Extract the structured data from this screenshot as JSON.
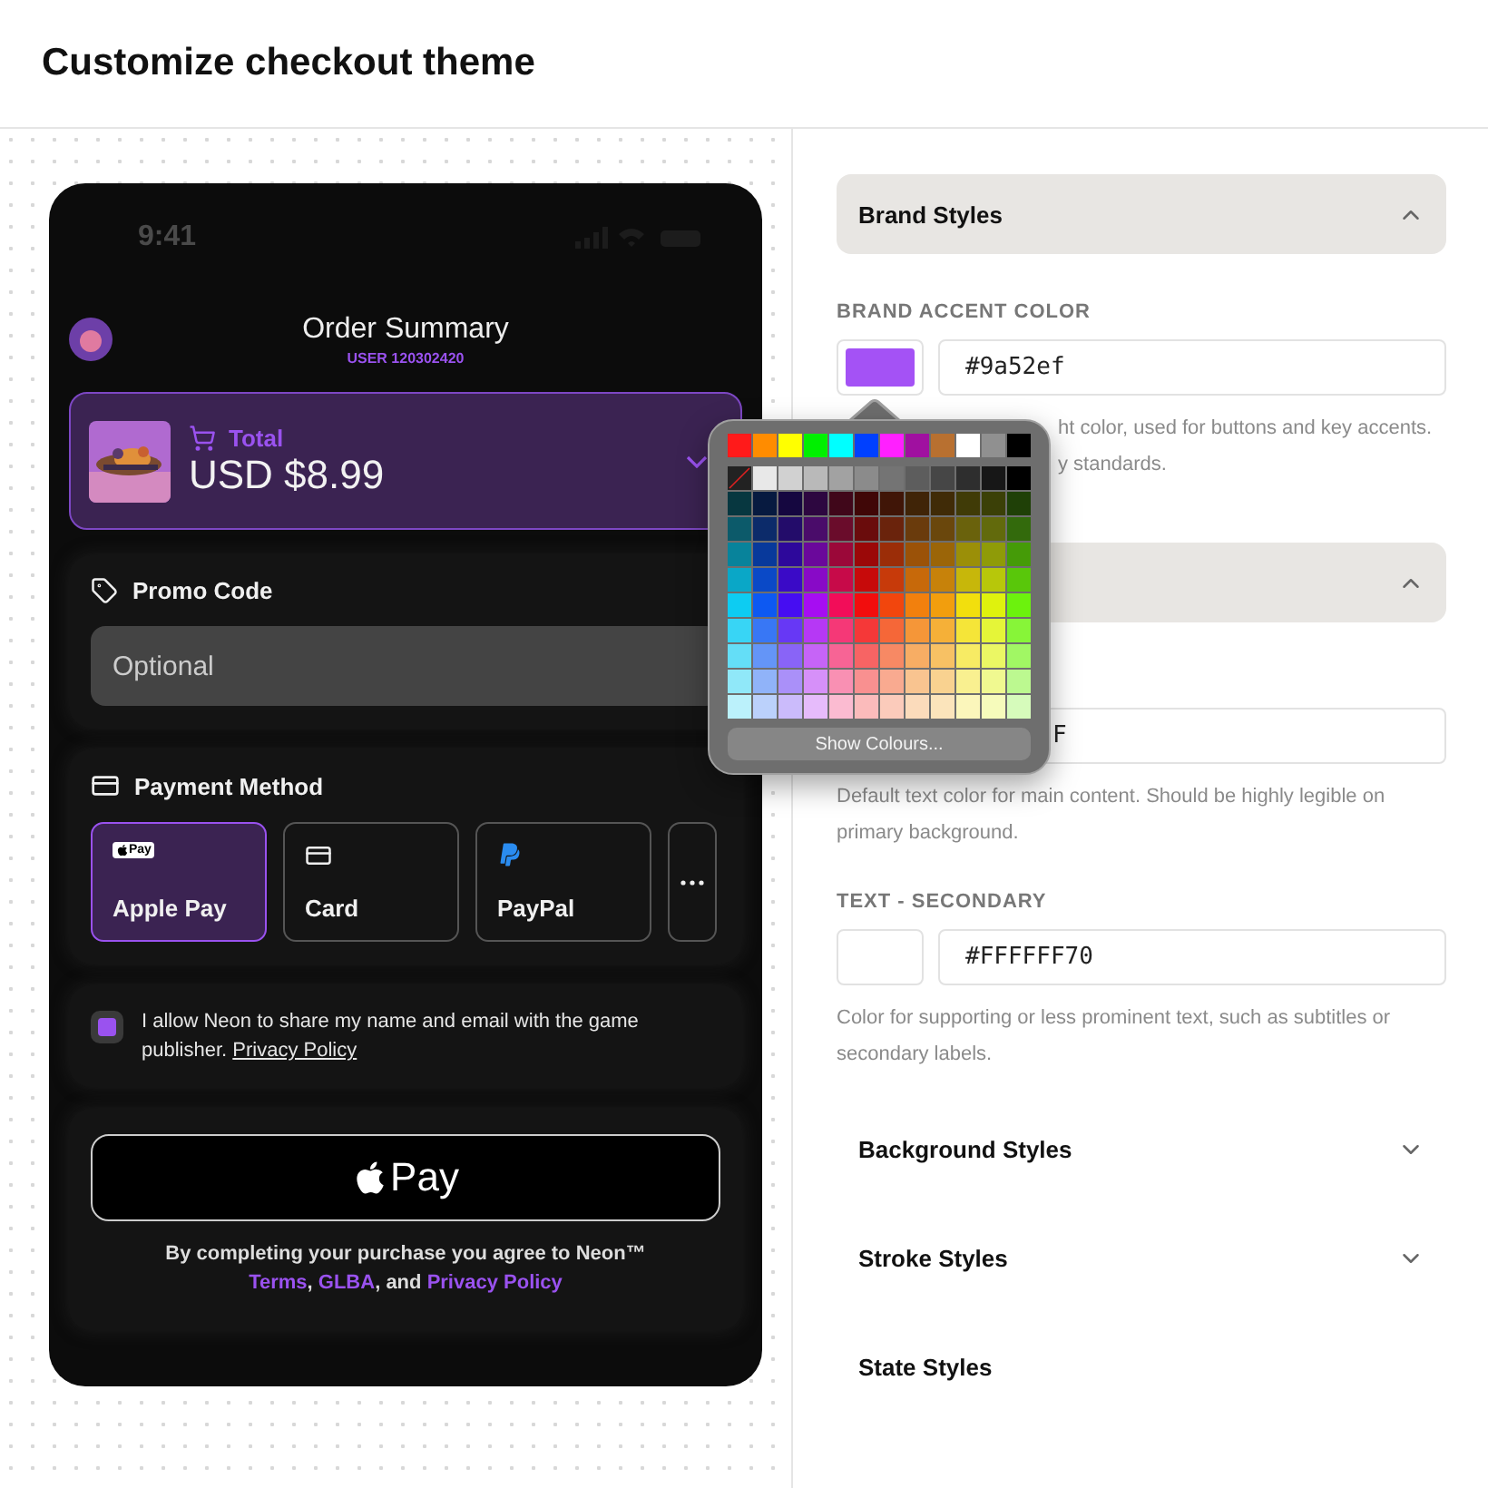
{
  "page_title": "Customize checkout theme",
  "phone": {
    "status_time": "9:41",
    "header": {
      "title": "Order Summary",
      "subtitle": "USER 120302420"
    },
    "total": {
      "label": "Total",
      "amount": "USD $8.99",
      "expanded": false
    },
    "promo": {
      "title": "Promo Code",
      "placeholder": "Optional"
    },
    "payment": {
      "title": "Payment Method",
      "methods": [
        {
          "kind": "applepay",
          "badge": "Pay",
          "label": "Apple Pay",
          "selected": true
        },
        {
          "kind": "card",
          "label": "Card",
          "selected": false
        },
        {
          "kind": "paypal",
          "label": "PayPal",
          "selected": false
        },
        {
          "kind": "more",
          "selected": false
        }
      ]
    },
    "consent": {
      "checked": true,
      "text": "I allow Neon to share my name and email with the game publisher.",
      "link": "Privacy Policy"
    },
    "pay_button": {
      "label": "Pay"
    },
    "legal": {
      "text": "By completing your purchase you agree to Neon™",
      "parts": [
        {
          "text": "Terms",
          "link": true
        },
        {
          "text": ", ",
          "link": false
        },
        {
          "text": "GLBA",
          "link": true
        },
        {
          "text": ", and ",
          "link": false
        },
        {
          "text": "Privacy Policy",
          "link": true
        }
      ]
    }
  },
  "settings": [
    {
      "kind": "header",
      "title": "Brand Styles",
      "expanded": true,
      "chevron": true
    },
    {
      "kind": "field",
      "label": "BRAND ACCENT COLOR",
      "color": "#a452f5",
      "value": "#9a52ef",
      "description_lines": [
        "ht color, used for buttons and key accents.",
        "y standards."
      ]
    },
    {
      "kind": "header",
      "expanded": true,
      "chevron": true
    },
    {
      "kind": "field",
      "value": "F",
      "description_lines": [
        "Default text color for main content. Should be highly legible on primary background."
      ]
    },
    {
      "kind": "field",
      "label": "TEXT - SECONDARY",
      "color": "#ffffff",
      "value": "#FFFFFF70",
      "description_lines": [
        "Color for supporting or less prominent text, such as subtitles or secondary labels."
      ]
    },
    {
      "kind": "header",
      "title": "Background Styles",
      "expanded": false,
      "chevron": true
    },
    {
      "kind": "header",
      "title": "Stroke Styles",
      "expanded": false,
      "chevron": true
    },
    {
      "kind": "header",
      "title": "State Styles",
      "expanded": false,
      "chevron": false
    }
  ],
  "color_picker": {
    "button": "Show Colours..."
  }
}
